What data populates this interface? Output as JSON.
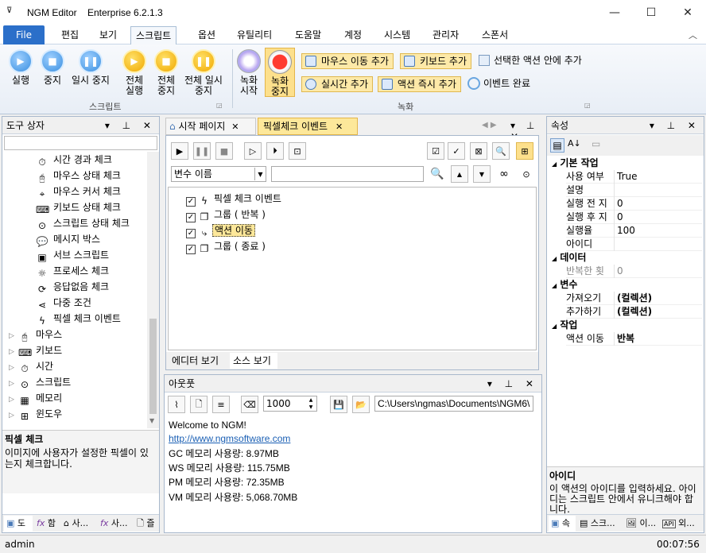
{
  "app": {
    "title": "NGM Editor",
    "edition": "Enterprise 6.2.1.3"
  },
  "menu": {
    "file": "File",
    "tabs": [
      "편집",
      "보기",
      "스크립트",
      "옵션",
      "유틸리티",
      "도움말",
      "계정",
      "시스템",
      "관리자",
      "스폰서"
    ]
  },
  "ribbon": {
    "script": {
      "run": "실행",
      "stop": "중지",
      "pause": "일시 중지",
      "run_all": "전체 실행",
      "stop_all": "전체 중지",
      "pause_all": "전체 일시 중지",
      "group": "스크립트"
    },
    "record": {
      "start": "녹화 시작",
      "stop": "녹화 중지",
      "add_mouse_move": "마우스 이동 추가",
      "add_keyboard": "키보드 추가",
      "add_in_selected": "선택한 액션 안에 추가",
      "add_real_time": "실시간 추가",
      "add_action_now": "액션 즉시 추가",
      "event_complete": "이벤트 완료",
      "group": "녹화"
    }
  },
  "toolbox": {
    "title": "도구 상자",
    "items": [
      {
        "label": "시간 경과 체크",
        "icon": "stopwatch-icon"
      },
      {
        "label": "마우스 상태 체크",
        "icon": "mouse-check-icon"
      },
      {
        "label": "마우스 커서 체크",
        "icon": "cursor-icon"
      },
      {
        "label": "키보드 상태 체크",
        "icon": "keyboard-icon"
      },
      {
        "label": "스크립트 상태 체크",
        "icon": "script-check-icon"
      },
      {
        "label": "메시지 박스",
        "icon": "message-icon"
      },
      {
        "label": "서브 스크립트",
        "icon": "sub-script-icon"
      },
      {
        "label": "프로세스 체크",
        "icon": "process-icon"
      },
      {
        "label": "응답없음 체크",
        "icon": "refresh-icon"
      },
      {
        "label": "다중 조건",
        "icon": "share-icon"
      },
      {
        "label": "픽셀 체크 이벤트",
        "icon": "lightning-icon"
      }
    ],
    "categories": [
      "마우스",
      "키보드",
      "시간",
      "스크립트",
      "메모리",
      "윈도우"
    ],
    "desc_title": "픽셀 체크",
    "desc_text": "이미지에 사용자가 설정한 픽셀이 있는지 체크합니다.",
    "bottom_tabs": [
      "도",
      "함",
      "사...",
      "사...",
      "즐"
    ]
  },
  "editor": {
    "tabs": [
      "시작 페이지",
      "픽셀체크 이벤트"
    ],
    "var_select": "변수 이름",
    "tree": [
      {
        "label": "픽셀 체크 이벤트",
        "icon": "lightning-icon"
      },
      {
        "label": "그룹 ( 반복 )",
        "icon": "group-icon"
      },
      {
        "label": "액션 이동",
        "icon": "action-move-icon"
      },
      {
        "label": "그룹 ( 종료 )",
        "icon": "group-icon"
      }
    ],
    "view_tabs": [
      "에디터 보기",
      "소스 보기"
    ]
  },
  "output": {
    "title": "아웃풋",
    "count": "1000",
    "path": "C:\\Users\\ngmas\\Documents\\NGM6\\",
    "lines": [
      "Welcome to NGM!",
      "http://www.ngmsoftware.com",
      "GC 메모리 사용량: 8.97MB",
      "WS 메모리 사용량: 115.75MB",
      "PM 메모리 사용량: 72.35MB",
      "VM 메모리 사용량: 5,068.70MB"
    ]
  },
  "properties": {
    "title": "속성",
    "cat_basic": "기본 작업",
    "enabled_k": "사용 여부",
    "enabled_v": "True",
    "desc_k": "설명",
    "before_k": "실행 전 지",
    "before_v": "0",
    "after_k": "실행 후 지",
    "after_v": "0",
    "rate_k": "실행율",
    "rate_v": "100",
    "id_k": "아이디",
    "cat_data": "데이터",
    "repeat_k": "반복한 횟",
    "repeat_v": "0",
    "cat_var": "변수",
    "get_k": "가져오기",
    "get_v": "(컬렉션)",
    "add_k": "추가하기",
    "add_v": "(컬렉션)",
    "cat_task": "작업",
    "move_k": "액션 이동",
    "move_v": "반복",
    "help_title": "아이디",
    "help_text": "이 액션의 아이디를 입력하세요. 아이디는 스크립트 안에서 유니크해야 합니다.",
    "bottom_tabs": [
      "속",
      "스크...",
      "이...",
      "외..."
    ]
  },
  "status": {
    "user": "admin",
    "time": "00:07:56"
  }
}
